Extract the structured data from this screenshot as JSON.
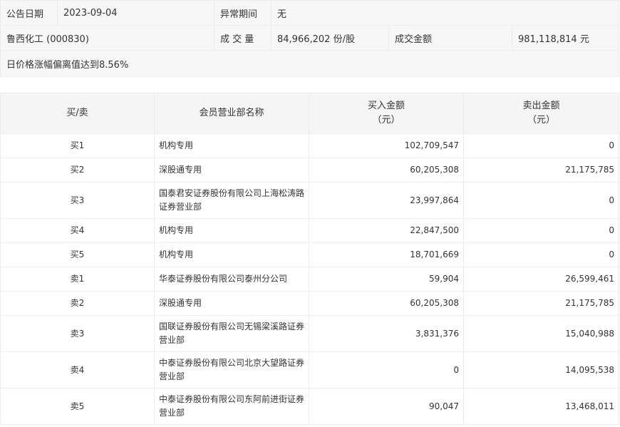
{
  "info": {
    "announce_label": "公告日期",
    "announce_value": "2023-09-04",
    "period_label": "异常期间",
    "period_value": "无",
    "stock_name": "鲁西化工 (000830)",
    "volume_label": "成 交 量",
    "volume_value": "84,966,202 份/股",
    "amount_label": "成交金额",
    "amount_value": "981,118,814 元",
    "reason": "日价格涨幅偏离值达到8.56%"
  },
  "table": {
    "headers": {
      "side": "买/卖",
      "branch": "会员营业部名称",
      "buy_l1": "买入金额",
      "buy_l2": "（元）",
      "sell_l1": "卖出金额",
      "sell_l2": "（元）"
    },
    "rows": [
      {
        "side": "买1",
        "branch": "机构专用",
        "buy": "102,709,547",
        "sell": "0"
      },
      {
        "side": "买2",
        "branch": "深股通专用",
        "buy": "60,205,308",
        "sell": "21,175,785"
      },
      {
        "side": "买3",
        "branch": "国泰君安证券股份有限公司上海松涛路证券营业部",
        "buy": "23,997,864",
        "sell": "0"
      },
      {
        "side": "买4",
        "branch": "机构专用",
        "buy": "22,847,500",
        "sell": "0"
      },
      {
        "side": "买5",
        "branch": "机构专用",
        "buy": "18,701,669",
        "sell": "0"
      },
      {
        "side": "卖1",
        "branch": "华泰证券股份有限公司泰州分公司",
        "buy": "59,904",
        "sell": "26,599,461"
      },
      {
        "side": "卖2",
        "branch": "深股通专用",
        "buy": "60,205,308",
        "sell": "21,175,785"
      },
      {
        "side": "卖3",
        "branch": "国联证券股份有限公司无锡梁溪路证券营业部",
        "buy": "3,831,376",
        "sell": "15,040,988"
      },
      {
        "side": "卖4",
        "branch": "中泰证券股份有限公司北京大望路证券营业部",
        "buy": "0",
        "sell": "14,095,538"
      },
      {
        "side": "卖5",
        "branch": "中泰证券股份有限公司东阿前进街证券营业部",
        "buy": "90,047",
        "sell": "13,468,011"
      }
    ]
  }
}
